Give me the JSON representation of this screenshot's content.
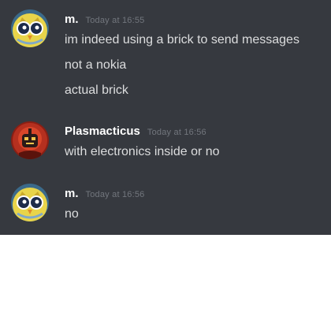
{
  "messages": [
    {
      "author": "m.",
      "timestamp": "Today at 16:55",
      "avatar": "yellow-owl-avatar",
      "lines": [
        "im indeed using a brick to send messages",
        "not a nokia",
        "actual brick"
      ]
    },
    {
      "author": "Plasmacticus",
      "timestamp": "Today at 16:56",
      "avatar": "red-robot-avatar",
      "lines": [
        "with electronics inside or no"
      ]
    },
    {
      "author": "m.",
      "timestamp": "Today at 16:56",
      "avatar": "yellow-owl-avatar",
      "lines": [
        "no"
      ]
    }
  ],
  "colors": {
    "chat_background": "#36393f",
    "username": "#ffffff",
    "timestamp": "#72767d",
    "message_text": "#dcddde",
    "page_background": "#ffffff"
  }
}
